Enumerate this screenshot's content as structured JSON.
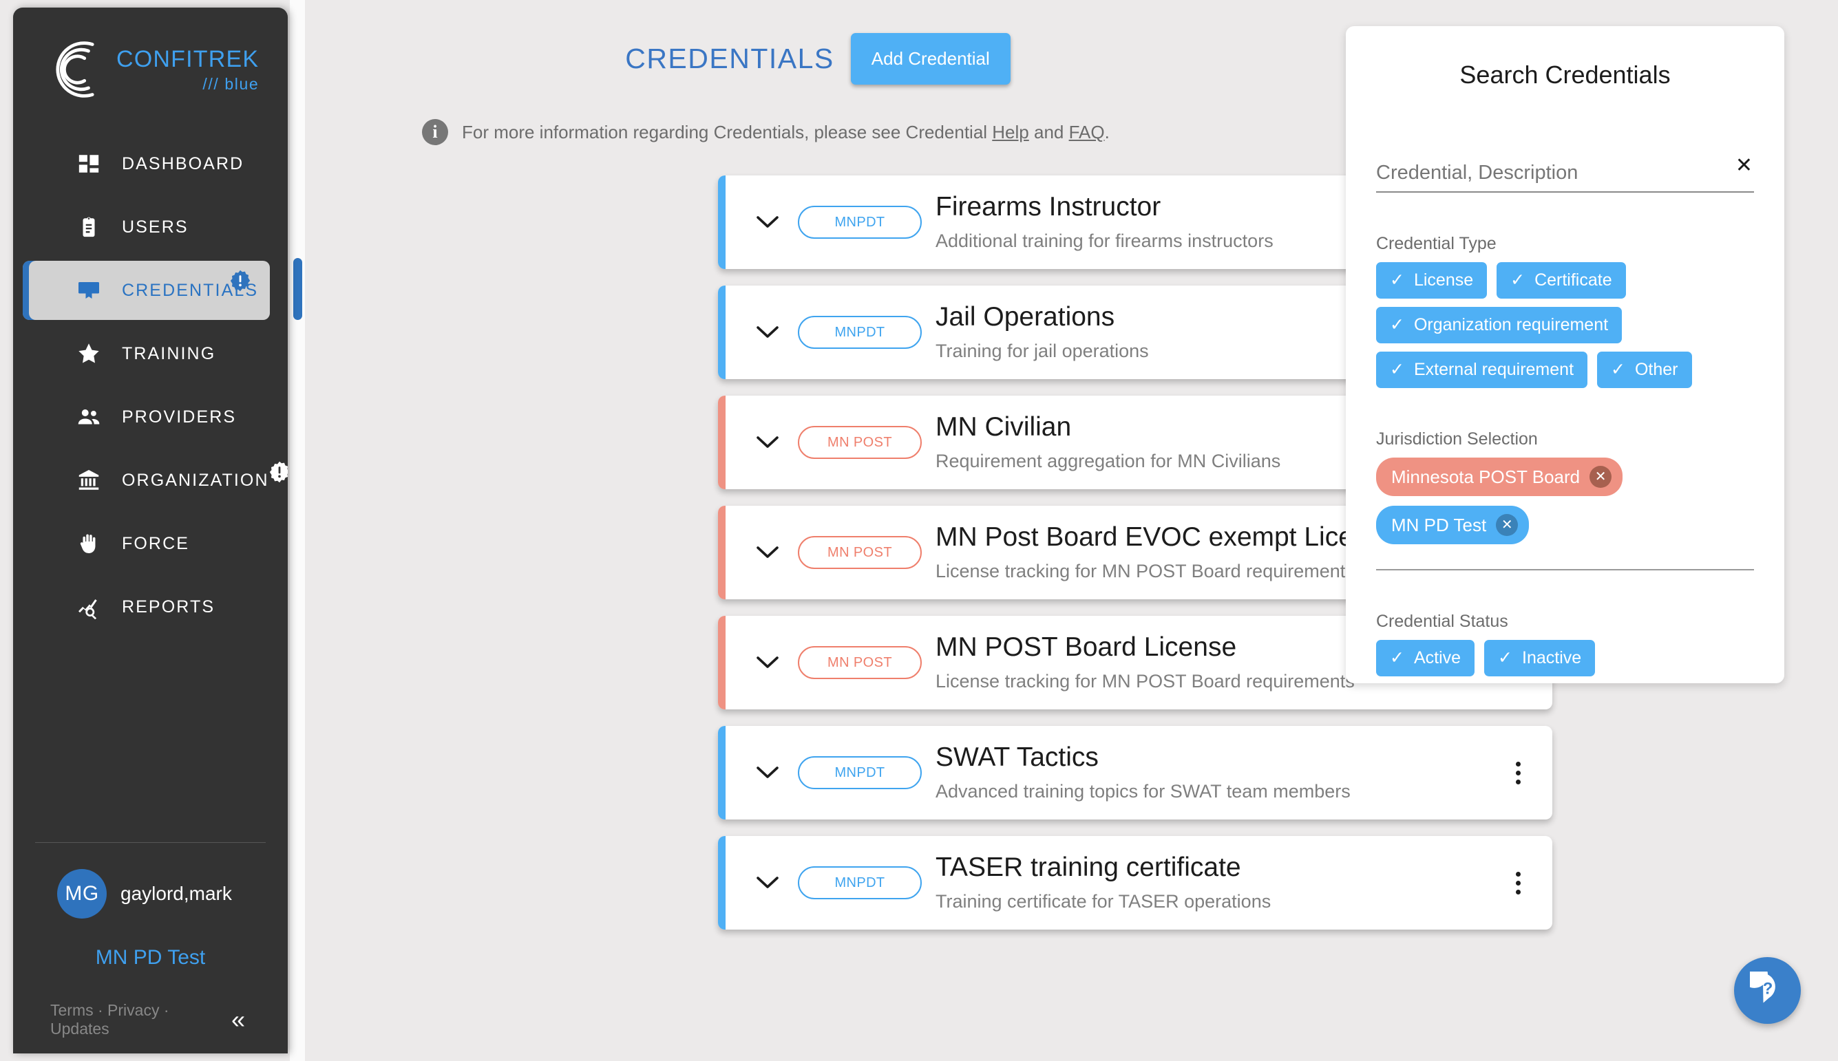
{
  "brand": {
    "name": "CONFITREK",
    "sub": "/// blue",
    "logo_icon": "confitrek-swirl-logo"
  },
  "sidebar": {
    "items": [
      {
        "label": "DASHBOARD",
        "icon": "dashboard-icon",
        "active": false,
        "badge": null
      },
      {
        "label": "USERS",
        "icon": "clipboard-users-icon",
        "active": false,
        "badge": null
      },
      {
        "label": "CREDENTIALS",
        "icon": "credential-card-icon",
        "active": true,
        "badge": "blue-alert-badge"
      },
      {
        "label": "TRAINING",
        "icon": "star-icon",
        "active": false,
        "badge": null
      },
      {
        "label": "PROVIDERS",
        "icon": "people-icon",
        "active": false,
        "badge": null
      },
      {
        "label": "ORGANIZATION",
        "icon": "bank-icon",
        "active": false,
        "badge": "white-alert-badge"
      },
      {
        "label": "FORCE",
        "icon": "hand-icon",
        "active": false,
        "badge": null
      },
      {
        "label": "REPORTS",
        "icon": "chart-search-icon",
        "active": false,
        "badge": null
      }
    ],
    "user": {
      "initials": "MG",
      "name": "gaylord,mark",
      "organization": "MN PD Test"
    },
    "footer_links": "Terms · Privacy · Updates",
    "collapse_icon": "chevron-double-left-icon"
  },
  "main": {
    "title": "CREDENTIALS",
    "add_button": "Add Credential",
    "info_icon": "info-icon",
    "info_prefix": "For more information regarding Credentials, please see Credential ",
    "info_link_help": "Help",
    "info_mid": " and ",
    "info_link_faq": "FAQ",
    "info_suffix": ".",
    "credentials": [
      {
        "pill": "MNPDT",
        "name": "Firearms Instructor",
        "description": "Additional training for firearms instructors",
        "accent": "#4fb0f5",
        "pill_color": "#3fa4ef"
      },
      {
        "pill": "MNPDT",
        "name": "Jail Operations",
        "description": "Training for jail operations",
        "accent": "#4fb0f5",
        "pill_color": "#3fa4ef"
      },
      {
        "pill": "MN POST",
        "name": "MN Civilian",
        "description": "Requirement aggregation for MN Civilians",
        "accent": "#ef9283",
        "pill_color": "#ef7f6c"
      },
      {
        "pill": "MN POST",
        "name": "MN Post Board EVOC exempt License",
        "description": "License tracking for MN POST Board requirements with EVOC",
        "accent": "#ef9283",
        "pill_color": "#ef7f6c"
      },
      {
        "pill": "MN POST",
        "name": "MN POST Board License",
        "description": "License tracking for MN POST Board requirements",
        "accent": "#ef9283",
        "pill_color": "#ef7f6c"
      },
      {
        "pill": "MNPDT",
        "name": "SWAT Tactics",
        "description": "Advanced training topics for SWAT team members",
        "accent": "#4fb0f5",
        "pill_color": "#3fa4ef"
      },
      {
        "pill": "MNPDT",
        "name": "TASER training certificate",
        "description": "Training certificate for TASER operations",
        "accent": "#4fb0f5",
        "pill_color": "#3fa4ef"
      }
    ]
  },
  "search_panel": {
    "title": "Search Credentials",
    "search_value": "",
    "search_placeholder": "Credential, Description",
    "clear_icon": "close-x-icon",
    "credential_type_label": "Credential Type",
    "credential_types": [
      {
        "label": "License",
        "checked": true
      },
      {
        "label": "Certificate",
        "checked": true
      },
      {
        "label": "Organization requirement",
        "checked": true
      },
      {
        "label": "External requirement",
        "checked": true
      },
      {
        "label": "Other",
        "checked": true
      }
    ],
    "jurisdiction_label": "Jurisdiction Selection",
    "jurisdictions": [
      {
        "label": "Minnesota POST Board",
        "color": "red"
      },
      {
        "label": "MN PD Test",
        "color": "blue"
      }
    ],
    "status_label": "Credential Status",
    "statuses": [
      {
        "label": "Active",
        "checked": true
      },
      {
        "label": "Inactive",
        "checked": true
      }
    ]
  },
  "help_fab": {
    "icon": "question-bubble-icon",
    "label": "?"
  },
  "colors": {
    "accent_blue": "#4fb0f5",
    "accent_red": "#ef9283",
    "brand_blue": "#3fa0ef",
    "sidebar_bg": "#333333",
    "page_bg": "#eceaea",
    "active_nav_bg": "#d2d2d2",
    "active_nav_text": "#2a73c2"
  }
}
